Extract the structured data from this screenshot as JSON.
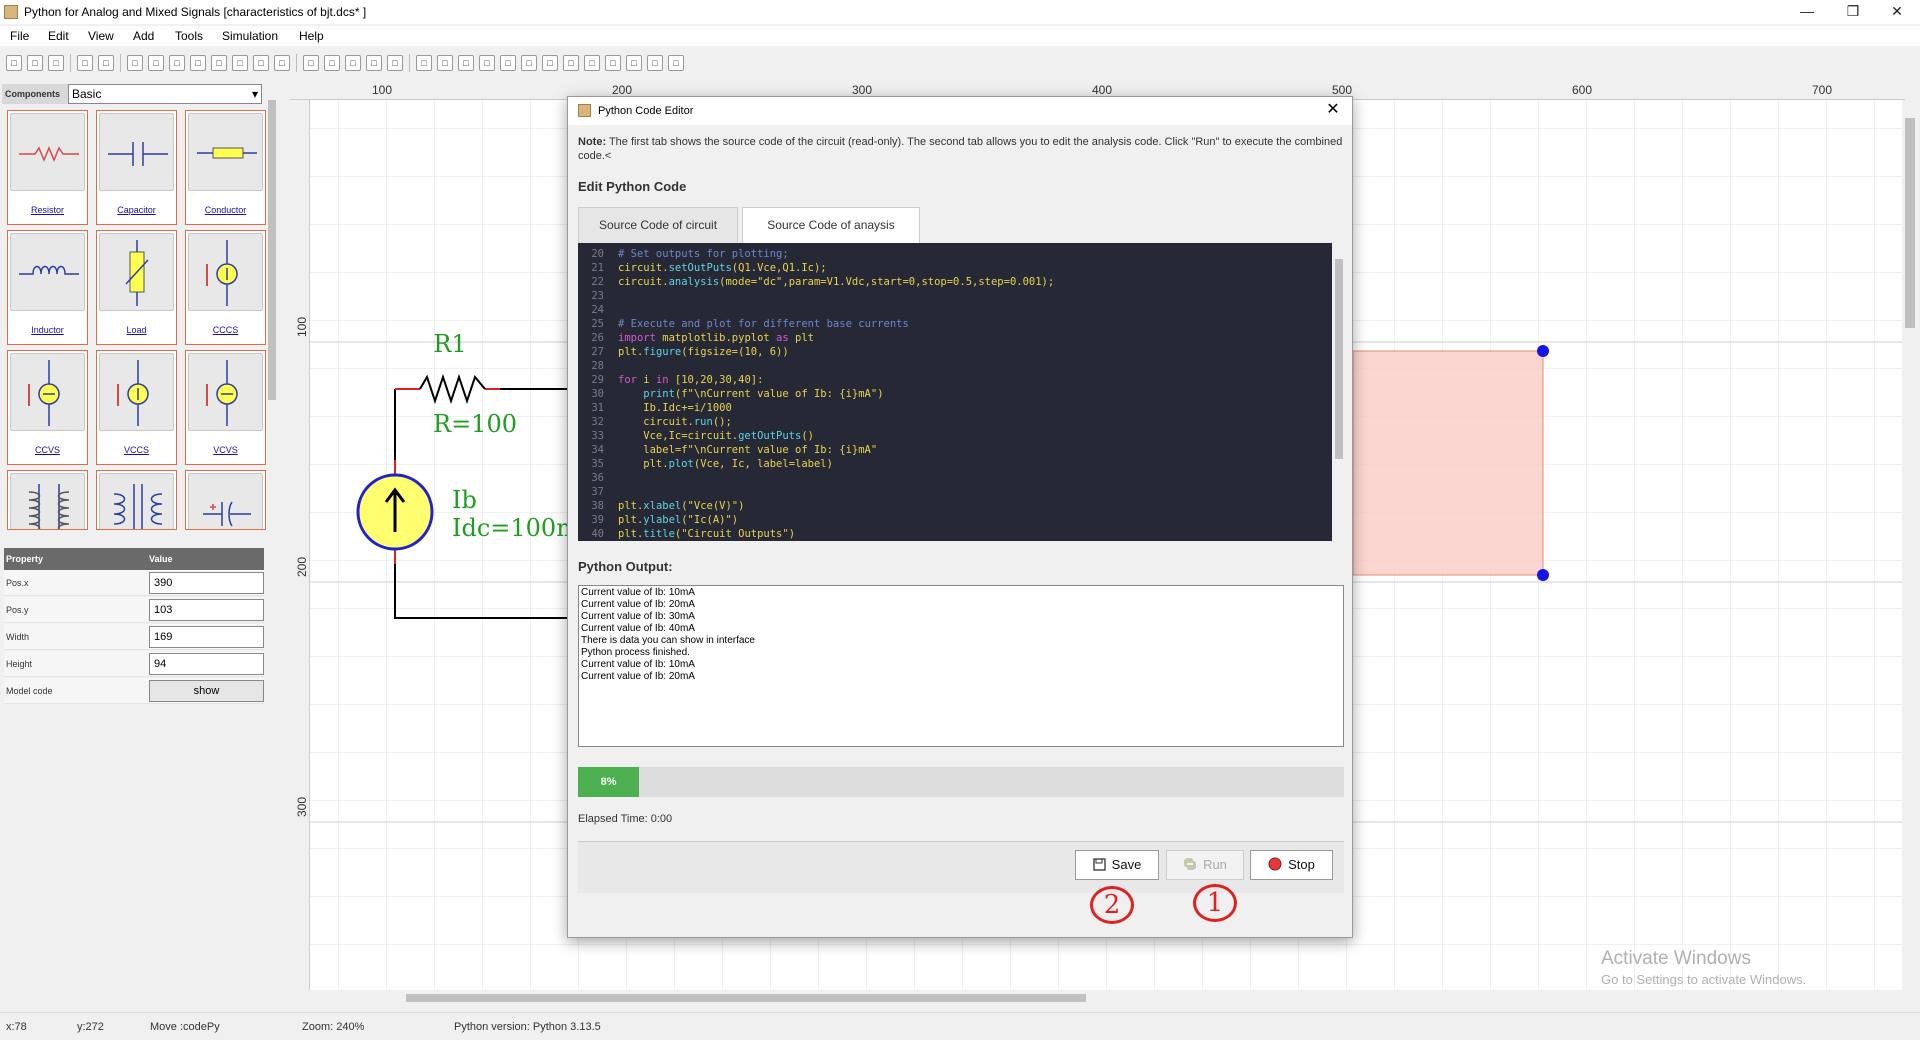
{
  "window": {
    "title": "Python for Analog and Mixed Signals [characteristics of bjt.dcs* ]",
    "controls": {
      "minimize": "—",
      "maximize": "❒",
      "close": "✕"
    }
  },
  "menu": [
    "File",
    "Edit",
    "View",
    "Add",
    "Tools",
    "Simulation",
    "Help"
  ],
  "toolbar_icons": [
    "new-file-icon",
    "open-folder-icon",
    "save-icon",
    "export-icon",
    "undo-icon",
    "redo-icon",
    "cut-icon",
    "copy-icon",
    "paste-icon",
    "group-icon",
    "ungroup-icon",
    "bring-front-icon",
    "send-back-icon",
    "zoom-in-icon",
    "zoom-out-icon",
    "flip-h-icon",
    "flip-v-icon",
    "rotate-icon",
    "pointer-icon",
    "text-icon",
    "wire-icon",
    "node-icon",
    "rect-icon",
    "ellipse-icon",
    "probe-icon",
    "ground-icon",
    "code-icon",
    "python-icon",
    "component-icon",
    "stop-sim-icon",
    "fit-icon"
  ],
  "components": {
    "label": "Components",
    "selected": "Basic",
    "items": [
      "Resistor",
      "Capacitor",
      "Conductor",
      "Inductor",
      "Load",
      "CCCS",
      "CCVS",
      "VCCS",
      "VCVS",
      "",
      "",
      ""
    ]
  },
  "properties": {
    "headers": {
      "property": "Property",
      "value": "Value"
    },
    "rows": [
      {
        "name": "Pos.x",
        "value": "390"
      },
      {
        "name": "Pos.y",
        "value": "103"
      },
      {
        "name": "Width",
        "value": "169"
      },
      {
        "name": "Height",
        "value": "94"
      },
      {
        "name": "Model code",
        "value": "show"
      }
    ]
  },
  "rulers": {
    "h": [
      "100",
      "200",
      "300",
      "400",
      "500",
      "600",
      "700"
    ],
    "v": [
      "100",
      "200",
      "300"
    ]
  },
  "schematic": {
    "r1_name": "R1",
    "r1_value": "R=100",
    "ib_name": "Ib",
    "ib_value": "Idc=100m"
  },
  "dialog": {
    "title": "Python Code Editor",
    "close": "✕",
    "note_label": "Note:",
    "note_text": " The first tab shows the source code of the circuit (read-only). The second tab allows you to edit the analysis code. Click \"Run\" to execute the combined code.<",
    "edit_heading": "Edit Python Code",
    "tabs": [
      "Source Code of circuit",
      "Source Code of anaysis"
    ],
    "active_tab": 1,
    "code_lines": [
      {
        "n": "20",
        "t": "# Set outputs for plotting;"
      },
      {
        "n": "21",
        "t": "circuit.setOutPuts(Q1.Vce,Q1.Ic);"
      },
      {
        "n": "22",
        "t": "circuit.analysis(mode=\"dc\",param=V1.Vdc,start=0,stop=0.5,step=0.001);"
      },
      {
        "n": "23",
        "t": ""
      },
      {
        "n": "24",
        "t": ""
      },
      {
        "n": "25",
        "t": "# Execute and plot for different base currents"
      },
      {
        "n": "26",
        "t": "import matplotlib.pyplot as plt"
      },
      {
        "n": "27",
        "t": "plt.figure(figsize=(10, 6))"
      },
      {
        "n": "28",
        "t": ""
      },
      {
        "n": "29",
        "t": "for i in [10,20,30,40]:"
      },
      {
        "n": "30",
        "t": "    print(f\"\\nCurrent value of Ib: {i}mA\")"
      },
      {
        "n": "31",
        "t": "    Ib.Idc+=i/1000"
      },
      {
        "n": "32",
        "t": "    circuit.run();"
      },
      {
        "n": "33",
        "t": "    Vce,Ic=circuit.getOutPuts()"
      },
      {
        "n": "34",
        "t": "    label=f\"\\nCurrent value of Ib: {i}mA\""
      },
      {
        "n": "35",
        "t": "    plt.plot(Vce, Ic, label=label)"
      },
      {
        "n": "36",
        "t": ""
      },
      {
        "n": "37",
        "t": ""
      },
      {
        "n": "38",
        "t": "plt.xlabel(\"Vce(V)\")"
      },
      {
        "n": "39",
        "t": "plt.ylabel(\"Ic(A)\")"
      },
      {
        "n": "40",
        "t": "plt.title(\"Circuit Outputs\")"
      }
    ],
    "output_heading": "Python Output:",
    "output_lines": [
      "Current value of Ib: 10mA",
      "Current value of Ib: 20mA",
      "Current value of Ib: 30mA",
      "Current value of Ib: 40mA",
      "There is data you can show in interface",
      "Python process finished.",
      "Current value of Ib: 10mA",
      "Current value of Ib: 20mA"
    ],
    "progress": {
      "percent": 8,
      "label": "8%"
    },
    "elapsed": "Elapsed Time: 0:00",
    "buttons": {
      "save": "Save",
      "run": "Run",
      "stop": "Stop"
    },
    "markers": {
      "save": "2",
      "run": "1"
    }
  },
  "status": {
    "x": "x:78",
    "y": "y:272",
    "mode": "Move :codePy",
    "zoom": "Zoom: 240%",
    "python": "Python version: Python 3.13.5"
  },
  "watermark": {
    "line1": "Activate Windows",
    "line2": "Go to Settings to activate Windows."
  },
  "colors": {
    "accent_progress": "#4caf50",
    "code_bg": "#272835",
    "marker_red": "#e02020",
    "card_border": "#e06c4a"
  }
}
